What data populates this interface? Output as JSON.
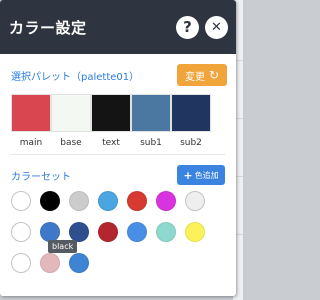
{
  "dialog": {
    "title": "カラー設定",
    "help_icon": "question-circle-icon",
    "help_label": "?",
    "close_icon": "close-circle-icon",
    "close_label": "✕"
  },
  "palette": {
    "label": "選択パレット（palette01）",
    "change_button": "変更",
    "change_icon": "refresh-icon",
    "swatches": [
      {
        "name": "main",
        "color": "#d9464f"
      },
      {
        "name": "base",
        "color": "#f3f9f2"
      },
      {
        "name": "text",
        "color": "#141414"
      },
      {
        "name": "sub1",
        "color": "#4b78a0"
      },
      {
        "name": "sub2",
        "color": "#203660"
      }
    ]
  },
  "colorset": {
    "label": "カラーセット",
    "add_button": "色追加",
    "add_icon": "plus-icon",
    "tooltip": "black",
    "rows": [
      [
        "#ffffff",
        "#000000",
        "#cccccc",
        "#4aa5e0",
        "#d63a30",
        "#d833df",
        "#eeeeee"
      ],
      [
        "#ffffff",
        "#3f78c9",
        "#2f4f8e",
        "#b3262f",
        "#4a8fe6",
        "#8fd8d0",
        "#fbf25a"
      ],
      [
        "#ffffff",
        "#e2b8bb",
        "#3e84d2"
      ]
    ]
  }
}
